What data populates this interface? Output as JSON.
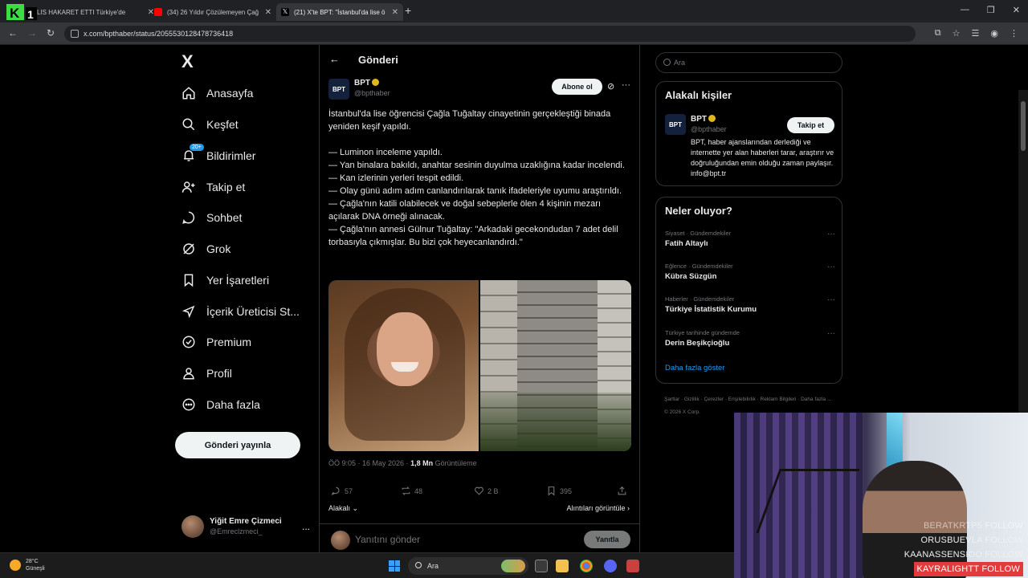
{
  "browser": {
    "tabs": [
      {
        "title": "LIS HAKARET ETTI Türkiye'de",
        "active": false,
        "color": "#4caf50"
      },
      {
        "title": "(34) 26 Yıldır Çözülemeyen Çağ",
        "active": false,
        "color": "#ff0000"
      },
      {
        "title": "(21) X'te BPT: \"İstanbul'da lise ö",
        "active": true,
        "color": "#ffffff"
      }
    ],
    "url": "x.com/bpthaber/status/2055530128478736418"
  },
  "sidebar": {
    "logo": "X",
    "items": [
      {
        "label": "Anasayfa",
        "icon": "home-icon"
      },
      {
        "label": "Keşfet",
        "icon": "search-icon"
      },
      {
        "label": "Bildirimler",
        "icon": "bell-icon",
        "badge": "20+"
      },
      {
        "label": "Takip et",
        "icon": "add-person-icon"
      },
      {
        "label": "Sohbet",
        "icon": "chat-icon"
      },
      {
        "label": "Grok",
        "icon": "grok-icon"
      },
      {
        "label": "Yer İşaretleri",
        "icon": "bookmark-icon"
      },
      {
        "label": "İçerik Üreticisi St...",
        "icon": "rocket-icon"
      },
      {
        "label": "Premium",
        "icon": "verified-icon"
      },
      {
        "label": "Profil",
        "icon": "person-icon"
      },
      {
        "label": "Daha fazla",
        "icon": "more-circle-icon"
      }
    ],
    "post_button": "Gönderi yayınla",
    "account": {
      "name": "Yiğit Emre Çizmeci",
      "handle": "@Emreclzmeci_",
      "more": "..."
    }
  },
  "post": {
    "header_title": "Gönderi",
    "author": {
      "name": "BPT",
      "handle": "@bpthaber",
      "avatar_text": "BPT"
    },
    "subscribe_label": "Abone ol",
    "text_lines": [
      "İstanbul'da lise öğrencisi Çağla Tuğaltay cinayetinin gerçekleştiği binada yeniden keşif yapıldı.",
      "",
      "— Luminon inceleme yapıldı.",
      "— Yan binalara bakıldı, anahtar sesinin duyulma uzaklığına kadar incelendi.",
      "— Kan izlerinin yerleri tespit edildi.",
      "— Olay günü adım adım canlandırılarak tanık ifadeleriyle uyumu araştırıldı.",
      "— Çağla'nın katili olabilecek ve doğal sebeplerle ölen 4 kişinin mezarı açılarak DNA örneği alınacak.",
      "— Çağla'nın annesi Gülnur Tuğaltay: \"Arkadaki gecekondudan 7 adet delil torbasıyla çıkmışlar. Bu bizi çok heyecanlandırdı.\""
    ],
    "time": "ÖÖ 9:05 · 16 May 2026 · ",
    "views": "1,8 Mn",
    "views_label": " Görüntüleme",
    "stats": {
      "replies": "57",
      "reposts": "48",
      "likes": "2 B",
      "bookmarks": "395"
    },
    "sort_label": "Alakalı",
    "quotes_label": "Alıntıları görüntüle",
    "reply_placeholder": "Yanıtını gönder",
    "reply_button": "Yanıtla"
  },
  "right": {
    "search_placeholder": "Ara",
    "related_title": "Alakalı kişiler",
    "related_person": {
      "name": "BPT",
      "handle": "@bpthaber",
      "avatar_text": "BPT",
      "follow_label": "Takip et",
      "bio": "BPT, haber ajanslarından derlediği ve internette yer alan haberleri tarar, araştırır ve doğruluğundan emin olduğu zaman paylaşır. info@bpt.tr"
    },
    "trends_title": "Neler oluyor?",
    "trends": [
      {
        "category": "Siyaset · Gündemdekiler",
        "name": "Fatih Altaylı"
      },
      {
        "category": "Eğlence · Gündemdekiler",
        "name": "Kübra Süzgün"
      },
      {
        "category": "Haberler · Gündemdekiler",
        "name": "Türkiye İstatistik Kurumu"
      },
      {
        "category": "Türkiye tarihinde gündemde",
        "name": "Derin Beşikçioğlu"
      }
    ],
    "show_more": "Daha fazla göster",
    "footer": "Şartlar · Gizlilik · Çerezler · Erişilebilirlik · Reklam Bilgileri · Daha fazla ... © 2026 X Corp."
  },
  "stream_overlay": {
    "lines": [
      "BERATKRTP5 FOLLOW",
      "ORUSBUEVLA FOLLOW",
      "KAANASSENSIOO FOLLOW",
      "KAYRALIGHTT FOLLOW"
    ]
  },
  "taskbar": {
    "temp": "28°C",
    "weather": "Güneşli",
    "search": "Ara"
  }
}
